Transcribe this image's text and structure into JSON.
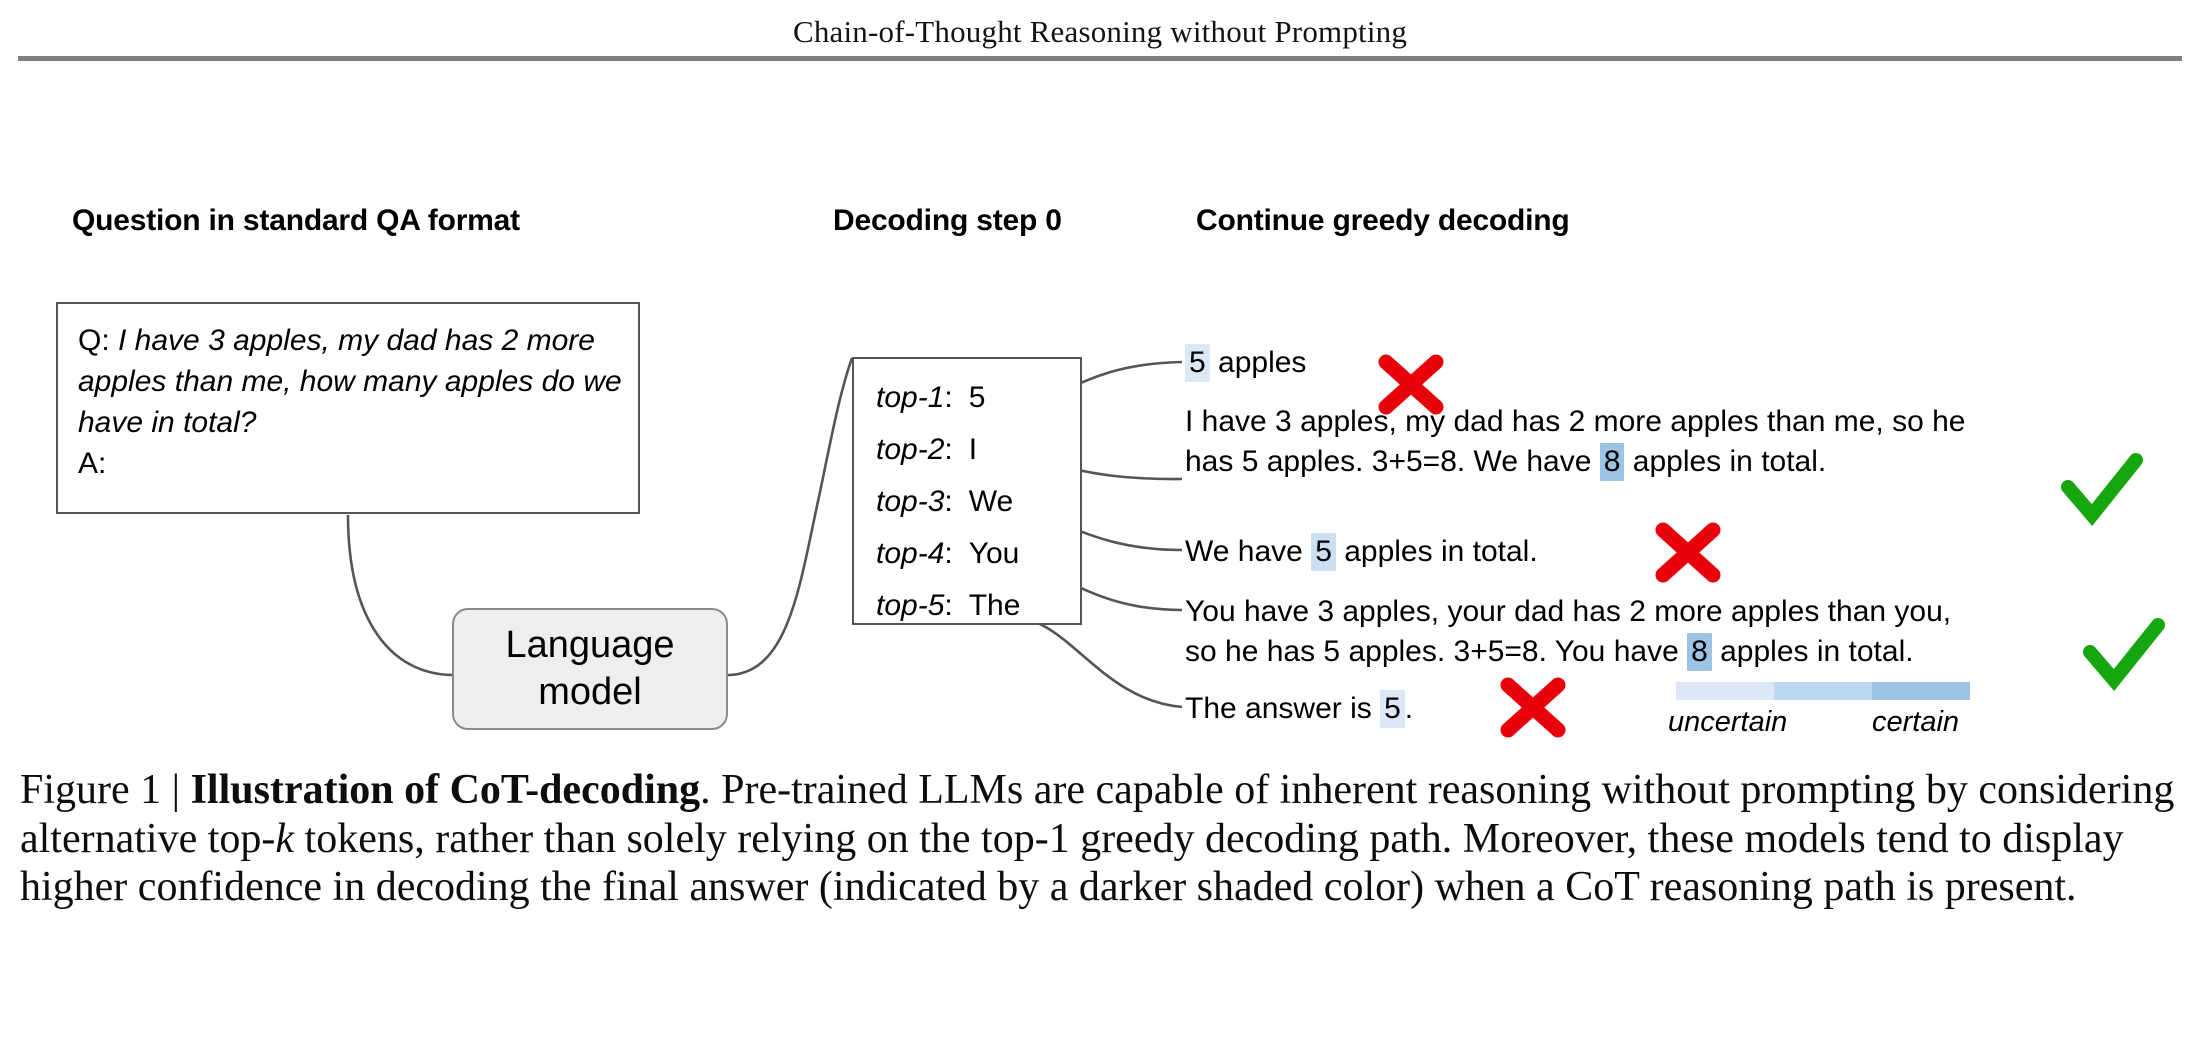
{
  "header": {
    "title": "Chain-of-Thought Reasoning without Prompting"
  },
  "figure": {
    "headings": {
      "question": "Question in standard QA format",
      "decoding": "Decoding step 0",
      "continue": "Continue greedy decoding"
    },
    "question_box": {
      "q_label": "Q: ",
      "q_body": "I have 3 apples, my dad has 2 more apples than me, how many apples do we have in total?",
      "a_label": "A:"
    },
    "language_model": {
      "line1": "Language",
      "line2": "model"
    },
    "topk": [
      {
        "rank": "top-1",
        "colon": ":",
        "token": "5"
      },
      {
        "rank": "top-2",
        "colon": ":",
        "token": "I"
      },
      {
        "rank": "top-3",
        "colon": ":",
        "token": "We"
      },
      {
        "rank": "top-4",
        "colon": ":",
        "token": "You"
      },
      {
        "rank": "top-5",
        "colon": ":",
        "token": "The"
      }
    ],
    "paths": [
      {
        "line1_pre": "",
        "highlight": "5",
        "line1_post": " apples",
        "line2": "",
        "verdict": "cross"
      },
      {
        "line1": "I have 3 apples, my dad has 2 more apples than me, so he",
        "line2_pre": "has 5 apples. 3+5=8. We have ",
        "highlight": "8",
        "line2_post": " apples in total.",
        "verdict": "check"
      },
      {
        "line1_pre": "We have ",
        "highlight": "5",
        "line1_post": " apples in total.",
        "line2": "",
        "verdict": "cross"
      },
      {
        "line1": "You have 3 apples, your dad has 2 more apples than you,",
        "line2_pre": "so he has 5 apples. 3+5=8. You have ",
        "highlight": "8",
        "line2_post": " apples in total.",
        "verdict": "check"
      },
      {
        "line1_pre": "The answer is ",
        "highlight": "5",
        "line1_post": ".",
        "line2": "",
        "verdict": "cross"
      }
    ],
    "legend": {
      "uncertain_label": "uncertain",
      "certain_label": "certain",
      "swatches": [
        "#dce8f5",
        "#bcd8f2",
        "#9cc3e4"
      ]
    },
    "colors": {
      "highlight_light": "#dce8f5",
      "highlight_mid": "#cbdff3",
      "highlight_dark": "#9cc3e4",
      "cross": "#e8000b",
      "check": "#16a610",
      "connector": "#555555",
      "box_border": "#555555",
      "lm_fill": "#eeeeee",
      "lm_border": "#8a8a8a",
      "rule": "#808080"
    }
  },
  "caption": {
    "figure_label": "Figure 1 | ",
    "bold_title": "Illustration of CoT-decoding",
    "body_part1": ". Pre-trained LLMs are capable of inherent reasoning without prompting by considering alternative top-",
    "italic_k": "k",
    "body_part2": " tokens, rather than solely relying on the top-1 greedy decoding path. Moreover, these models tend to display higher confidence in decoding the final answer (indicated by a darker shaded color) when a CoT reasoning path is present."
  }
}
